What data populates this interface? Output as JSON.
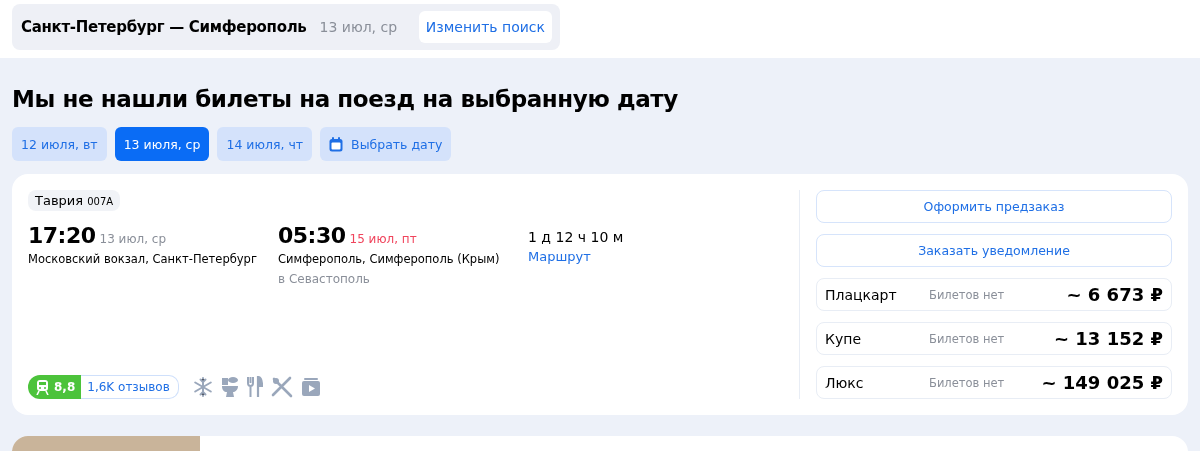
{
  "search_summary": {
    "route": "Санкт-Петербург — Симферополь",
    "date": "13 июл, ср",
    "change_button": "Изменить поиск"
  },
  "heading": "Мы не нашли билеты на поезд на выбранную дату",
  "date_chips": [
    {
      "label": "12 июля, вт",
      "selected": false
    },
    {
      "label": "13 июля, ср",
      "selected": true
    },
    {
      "label": "14 июля, чт",
      "selected": false
    }
  ],
  "pick_date_button": "Выбрать дату",
  "train": {
    "name": "Таврия",
    "number": "007А",
    "departure": {
      "time": "17:20",
      "date": "13 июл, ср",
      "station": "Московский вокзал, Санкт-Петербург"
    },
    "arrival": {
      "time": "05:30",
      "date": "15 июл, пт",
      "station": "Симферополь, Симферополь (Крым)",
      "note": "в Севастополь"
    },
    "duration": "1 д 12 ч 10 м",
    "route_link": "Маршрут",
    "rating": "8,8",
    "reviews": "1,6K отзывов",
    "amenities": [
      {
        "kind": "snowflake"
      },
      {
        "kind": "toilet"
      },
      {
        "kind": "cutlery"
      },
      {
        "kind": "crossed-cutlery"
      },
      {
        "kind": "video"
      }
    ],
    "actions": [
      "Оформить предзаказ",
      "Заказать уведомление"
    ],
    "classes": [
      {
        "name": "Плацкарт",
        "availability": "Билетов нет",
        "price": "~ 6 673 ₽"
      },
      {
        "name": "Купе",
        "availability": "Билетов нет",
        "price": "~ 13 152 ₽"
      },
      {
        "name": "Люкс",
        "availability": "Билетов нет",
        "price": "~ 149 025 ₽"
      }
    ]
  }
}
